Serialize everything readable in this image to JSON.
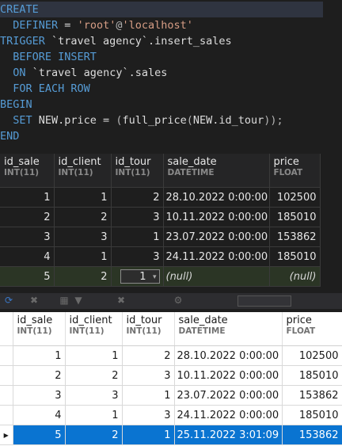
{
  "editor": {
    "lines": [
      {
        "indent": "",
        "parts": [
          {
            "t": "CREATE",
            "c": "kw"
          }
        ]
      },
      {
        "indent": "  ",
        "parts": [
          {
            "t": "DEFINER",
            "c": "kw"
          },
          {
            "t": " = ",
            "c": ""
          },
          {
            "t": "'root'",
            "c": "str"
          },
          {
            "t": "@",
            "c": "at"
          },
          {
            "t": "'localhost'",
            "c": "str"
          }
        ]
      },
      {
        "indent": "",
        "parts": [
          {
            "t": "TRIGGER",
            "c": "kw"
          },
          {
            "t": " `travel agency`.insert_sales",
            "c": ""
          }
        ]
      },
      {
        "indent": "  ",
        "parts": [
          {
            "t": "BEFORE INSERT",
            "c": "kw"
          }
        ]
      },
      {
        "indent": "  ",
        "parts": [
          {
            "t": "ON",
            "c": "kw"
          },
          {
            "t": " `travel agency`.sales",
            "c": ""
          }
        ]
      },
      {
        "indent": "  ",
        "parts": [
          {
            "t": "FOR EACH ROW",
            "c": "kw"
          }
        ]
      },
      {
        "indent": "",
        "parts": [
          {
            "t": "BEGIN",
            "c": "kw"
          }
        ]
      },
      {
        "indent": "  ",
        "parts": [
          {
            "t": "SET",
            "c": "kw"
          },
          {
            "t": " NEW.price = ",
            "c": ""
          },
          {
            "t": "(",
            "c": "par"
          },
          {
            "t": "full_price",
            "c": ""
          },
          {
            "t": "(",
            "c": "par"
          },
          {
            "t": "NEW.id_tour",
            "c": ""
          },
          {
            "t": "));",
            "c": "par"
          }
        ]
      },
      {
        "indent": "",
        "parts": [
          {
            "t": "END",
            "c": "kw"
          }
        ]
      }
    ]
  },
  "columns": [
    {
      "name": "id_sale",
      "type": "INT(11)"
    },
    {
      "name": "id_client",
      "type": "INT(11)"
    },
    {
      "name": "id_tour",
      "type": "INT(11)"
    },
    {
      "name": "sale_date",
      "type": "DATETIME"
    },
    {
      "name": "price",
      "type": "FLOAT"
    }
  ],
  "grid_before": {
    "rows": [
      [
        "1",
        "1",
        "2",
        "28.10.2022 0:00:00",
        "102500"
      ],
      [
        "2",
        "2",
        "3",
        "10.11.2022 0:00:00",
        "185010"
      ],
      [
        "3",
        "3",
        "1",
        "23.07.2022 0:00:00",
        "153862"
      ],
      [
        "4",
        "1",
        "3",
        "24.11.2022 0:00:00",
        "185010"
      ]
    ],
    "new_row": {
      "id_sale": "5",
      "id_client": "2",
      "id_tour_editing": "1",
      "sale_date": "(null)",
      "price": "(null)"
    }
  },
  "grid_after": {
    "rows": [
      [
        "1",
        "1",
        "2",
        "28.10.2022 0:00:00",
        "102500"
      ],
      [
        "2",
        "2",
        "3",
        "10.11.2022 0:00:00",
        "185010"
      ],
      [
        "3",
        "3",
        "1",
        "23.07.2022 0:00:00",
        "153862"
      ],
      [
        "4",
        "1",
        "3",
        "24.11.2022 0:00:00",
        "185010"
      ],
      [
        "5",
        "2",
        "1",
        "25.11.2022 3:01:09",
        "153862"
      ]
    ],
    "selected_row_index": 4
  },
  "icons": {
    "toolbar": [
      "refresh-icon",
      "cancel-icon",
      "grid-icon",
      "filter-icon",
      "filter-cancel-icon",
      "settings-icon"
    ],
    "row_pointer": "triangle-right-icon"
  },
  "colors": {
    "selection": "#0a74d1",
    "new_row": "#2b3525",
    "keyword": "#569cd6",
    "string": "#d69d85"
  }
}
